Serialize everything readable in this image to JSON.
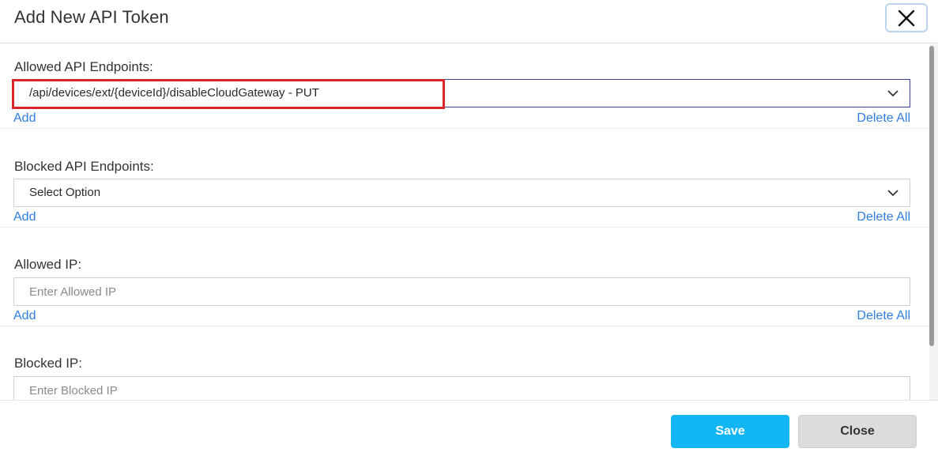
{
  "modal": {
    "title": "Add New API Token",
    "close_icon": "close-icon"
  },
  "sections": {
    "allowed_endpoints": {
      "label": "Allowed API Endpoints:",
      "selected": "/api/devices/ext/{deviceId}/disableCloudGateway - PUT",
      "add": "Add",
      "delete_all": "Delete All"
    },
    "blocked_endpoints": {
      "label": "Blocked API Endpoints:",
      "selected": "Select Option",
      "add": "Add",
      "delete_all": "Delete All"
    },
    "allowed_ip": {
      "label": "Allowed IP:",
      "placeholder": "Enter Allowed IP",
      "value": "",
      "add": "Add",
      "delete_all": "Delete All"
    },
    "blocked_ip": {
      "label": "Blocked IP:",
      "placeholder": "Enter Blocked IP",
      "value": ""
    }
  },
  "footer": {
    "save_label": "Save",
    "close_label": "Close"
  },
  "colors": {
    "link": "#2f7ee0",
    "save_button": "#13b6f5",
    "highlight": "#d8262b"
  }
}
